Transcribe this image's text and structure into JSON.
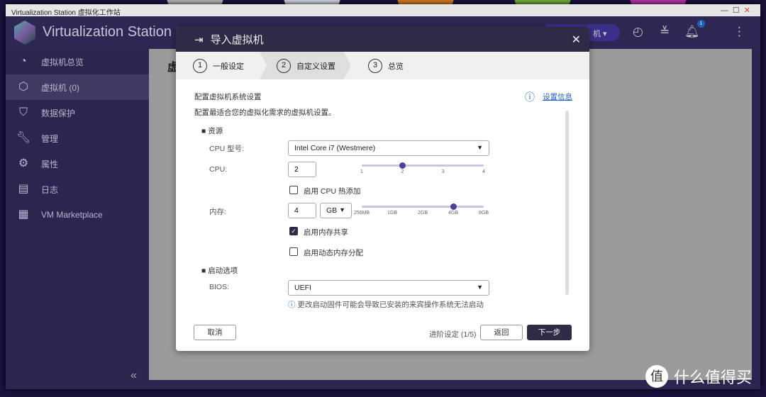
{
  "window": {
    "title": "Virtualization Station 虚拟化工作站",
    "app_name": "Virtualization Station",
    "header_pill": "机",
    "notification_count": "1"
  },
  "sidebar": {
    "items": [
      {
        "label": "虚拟机总览"
      },
      {
        "label": "虚拟机 (0)"
      },
      {
        "label": "数据保护"
      },
      {
        "label": "管理"
      },
      {
        "label": "属性"
      },
      {
        "label": "日志"
      },
      {
        "label": "VM Marketplace"
      }
    ]
  },
  "main": {
    "title": "虚"
  },
  "dialog": {
    "title": "导入虚拟机",
    "steps": [
      {
        "num": "1",
        "label": "一般设定"
      },
      {
        "num": "2",
        "label": "自定义设置"
      },
      {
        "num": "3",
        "label": "总览"
      }
    ],
    "section_title": "配置虚拟机系统设置",
    "section_desc": "配置最适合您的虚拟化需求的虚拟机设置。",
    "info_link": "设置信息",
    "resources_heading": "■ 资源",
    "cpu_model_label": "CPU 型号:",
    "cpu_model_value": "Intel Core i7 (Westmere)",
    "cpu_label": "CPU:",
    "cpu_value": "2",
    "cpu_ticks": [
      "1",
      "2",
      "3",
      "4"
    ],
    "cpu_slider_fraction": 0.333,
    "cpu_hotplug_label": "启用 CPU 热添加",
    "cpu_hotplug_checked": false,
    "memory_label": "内存:",
    "memory_value": "4",
    "memory_unit": "GB",
    "memory_ticks": [
      "256MB",
      "1GB",
      "2GB",
      "4GB",
      "8GB"
    ],
    "memory_slider_fraction": 0.75,
    "mem_share_label": "启用内存共享",
    "mem_share_checked": true,
    "dyn_mem_label": "启用动态内存分配",
    "dyn_mem_checked": false,
    "boot_heading": "■ 启动选项",
    "bios_label": "BIOS:",
    "bios_value": "UEFI",
    "bios_note": "更改启动固件可能会导致已安装的来宾操作系统无法启动",
    "cancel": "取消",
    "progress": "进阶设定 (1/5)",
    "back": "返回",
    "next": "下一步"
  },
  "watermark": {
    "text": "什么值得买",
    "logo": "值"
  }
}
